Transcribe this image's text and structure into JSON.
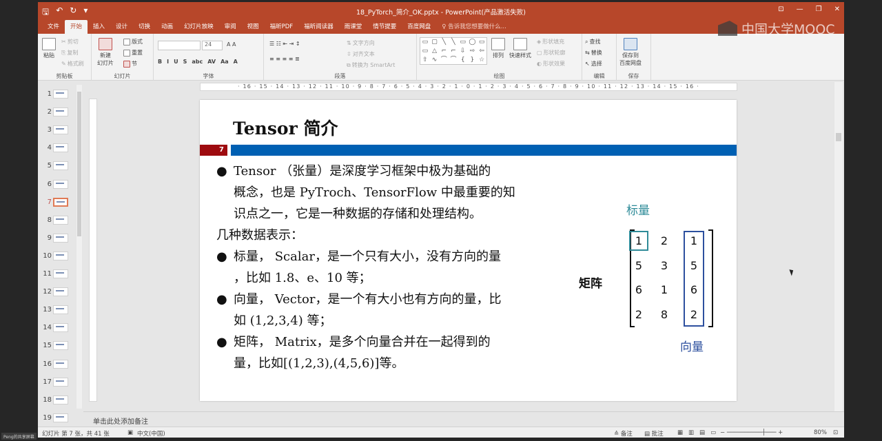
{
  "window": {
    "title": "18_PyTorch_简介_OK.pptx - PowerPoint(产品激活失败)",
    "controls": [
      "⊡",
      "—",
      "❐",
      "✕"
    ],
    "quick_access": [
      "🖫",
      "↶",
      "↻",
      "▾"
    ]
  },
  "tabs": [
    "文件",
    "开始",
    "插入",
    "设计",
    "切换",
    "动画",
    "幻灯片放映",
    "审阅",
    "视图",
    "福昕PDF",
    "福昕阅读器",
    "雨课堂",
    "情节提要",
    "百度网盘"
  ],
  "active_tab": 1,
  "tell_me": "♀ 告诉我您想要做什么...",
  "ribbon": {
    "clipboard": {
      "label": "剪贴板",
      "paste": "粘贴",
      "cut": "剪切",
      "copy": "复制",
      "format_painter": "格式刷"
    },
    "slides": {
      "label": "幻灯片",
      "new_slide": "新建\n幻灯片",
      "layout": "版式",
      "reset": "重置",
      "section": "节"
    },
    "font": {
      "label": "字体",
      "size": "24",
      "buttons": [
        "B",
        "I",
        "U",
        "S",
        "abc",
        "AV",
        "Aa",
        "A"
      ]
    },
    "paragraph": {
      "label": "段落",
      "text_direction": "文字方向",
      "align_text": "对齐文本",
      "smartart": "转换为 SmartArt"
    },
    "drawing": {
      "label": "绘图",
      "shapes": [
        "▭",
        "▢",
        "╲",
        "╲",
        "▭",
        "◯",
        "▭",
        "▭",
        "△",
        "⌐",
        "⌐",
        "⇩",
        "⇨",
        "⇦",
        "⇧",
        "∿",
        "⌒",
        "⌒",
        "{",
        "}",
        "☆"
      ],
      "arrange": "排列",
      "quick_styles": "快速样式",
      "fill": "形状填充",
      "outline": "形状轮廓",
      "effects": "形状效果"
    },
    "editing": {
      "label": "编辑",
      "find": "查找",
      "replace": "替换",
      "select": "选择"
    },
    "save": {
      "label": "保存",
      "save_to": "保存到\n百度网盘"
    }
  },
  "thumbnails": [
    1,
    2,
    3,
    4,
    5,
    6,
    7,
    8,
    9,
    10,
    11,
    12,
    13,
    14,
    15,
    16,
    17,
    18,
    19
  ],
  "selected_slide": 7,
  "ruler": "· 16 · 15 · 14 · 13 · 12 · 11 · 10 · 9 · 8 · 7 · 6 · 5 · 4 · 3 · 2 · 1 · 0 · 1 · 2 · 3 · 4 · 5 · 6 · 7 · 8 · 9 · 10 · 11 · 12 · 13 · 14 · 15 · 16 ·",
  "slide": {
    "title": "Tensor 简介",
    "page_number": "7",
    "paragraphs": [
      {
        "bullet": true,
        "lines": [
          "Tensor （张量）是深度学习框架中极为基础的",
          "概念，也是 PyTroch、TensorFlow 中最重要的知",
          "识点之一，它是一种数据的存储和处理结构。"
        ]
      },
      {
        "bullet": false,
        "lines": [
          "几种数据表示："
        ]
      },
      {
        "bullet": true,
        "lines": [
          "标量， Scalar，是一个只有大小，没有方向的量",
          "，比如 1.8、e、10 等；"
        ]
      },
      {
        "bullet": true,
        "lines": [
          "向量， Vector，是一个有大小也有方向的量，比",
          "如 (1,2,3,4) 等；"
        ]
      },
      {
        "bullet": true,
        "lines": [
          "矩阵， Matrix，是多个向量合并在一起得到的",
          "量，比如[(1,2,3),(4,5,6)]等。"
        ]
      }
    ],
    "bullet_glyph": "●",
    "label_scalar": "标量",
    "label_matrix": "矩阵",
    "label_vector": "向量",
    "matrix": [
      [
        "1",
        "2",
        "1"
      ],
      [
        "5",
        "3",
        "5"
      ],
      [
        "6",
        "1",
        "6"
      ],
      [
        "2",
        "8",
        "2"
      ]
    ],
    "colors": {
      "page_box": "#9e0b0f",
      "bar": "#0060b3",
      "scalar": "#2e8b98",
      "vector": "#2c4f9e"
    }
  },
  "notes_placeholder": "单击此处添加备注",
  "status": {
    "slide_info": "幻灯片 第 7 张，共 41 张",
    "language": "中文(中国)",
    "notes": "备注",
    "comments": "批注",
    "zoom": "80%"
  },
  "watermark": "中国大学MOOC",
  "share_tag": "Peng的共享屏幕"
}
